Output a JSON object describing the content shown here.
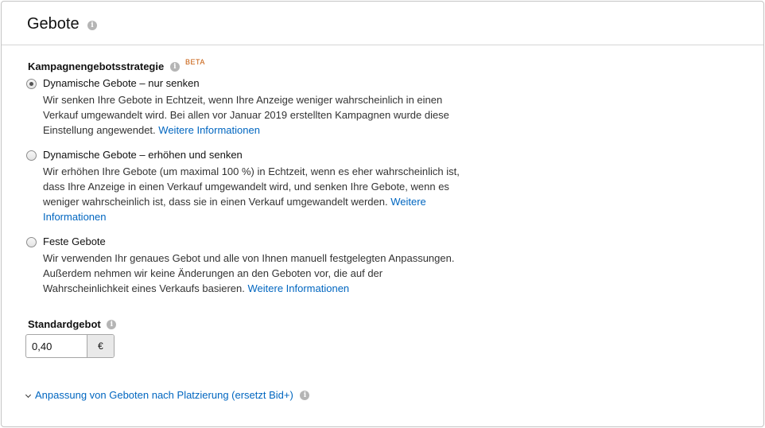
{
  "header": {
    "title": "Gebote",
    "info_icon": "info-icon"
  },
  "strategy": {
    "label": "Kampagnengebotsstrategie",
    "badge": "BETA",
    "selected": 0,
    "options": [
      {
        "title": "Dynamische Gebote – nur senken",
        "desc_lines": [
          "Wir senken Ihre Gebote in Echtzeit, wenn Ihre Anzeige weniger wahrscheinlich in einen",
          "Verkauf umgewandelt wird. Bei allen vor Januar 2019 erstellten Kampagnen wurde diese",
          "Einstellung angewendet."
        ],
        "link": "Weitere Informationen"
      },
      {
        "title": "Dynamische Gebote – erhöhen und senken",
        "desc_lines": [
          "Wir erhöhen Ihre Gebote (um maximal 100 %) in Echtzeit, wenn es eher wahrscheinlich ist,",
          "dass Ihre Anzeige in einen Verkauf umgewandelt wird, und senken Ihre Gebote, wenn es",
          "weniger wahrscheinlich ist, dass sie in einen Verkauf umgewandelt werden."
        ],
        "link_part1": "Weitere",
        "link_part2": "Informationen"
      },
      {
        "title": "Feste Gebote",
        "desc_lines": [
          "Wir verwenden Ihr genaues Gebot und alle von Ihnen manuell festgelegten Anpassungen.",
          "Außerdem nehmen wir keine Änderungen an den Geboten vor, die auf der",
          "Wahrscheinlichkeit eines Verkaufs basieren."
        ],
        "link": "Weitere Informationen"
      }
    ]
  },
  "default_bid": {
    "label": "Standardgebot",
    "value": "0,40",
    "currency": "€"
  },
  "placement": {
    "label": "Anpassung von Geboten nach Platzierung (ersetzt Bid+)",
    "chevron_icon": "chevron-down-icon"
  },
  "colors": {
    "link": "#0066c0",
    "beta": "#c45500",
    "border": "#c4c4c4"
  }
}
